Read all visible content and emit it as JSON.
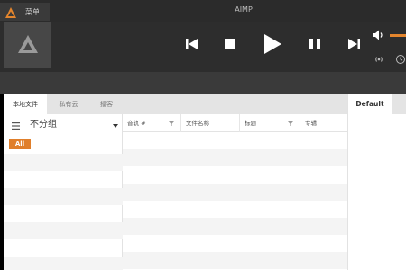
{
  "app": {
    "title": "AIMP",
    "menu_label": "菜单"
  },
  "colors": {
    "accent": "#e3852d",
    "header_bg": "#2d2d2d",
    "album_bg": "#474747",
    "tab_bg": "#e4e4e4"
  },
  "player": {
    "buttons": [
      "previous-icon",
      "stop-icon",
      "play-icon",
      "pause-icon",
      "next-icon",
      "volume-icon",
      "radio-icon",
      "timer-icon"
    ]
  },
  "sources": {
    "tabs": [
      {
        "label": "本地文件",
        "active": true
      },
      {
        "label": "私有云",
        "active": false
      },
      {
        "label": "播客",
        "active": false
      }
    ]
  },
  "groups": {
    "label": "不分组",
    "all_badge": "All"
  },
  "tracklist": {
    "columns": [
      {
        "label": "音轨 #"
      },
      {
        "label": "文件名称"
      },
      {
        "label": "标题"
      },
      {
        "label": "专辑"
      }
    ]
  },
  "playlist": {
    "tab": "Default"
  }
}
